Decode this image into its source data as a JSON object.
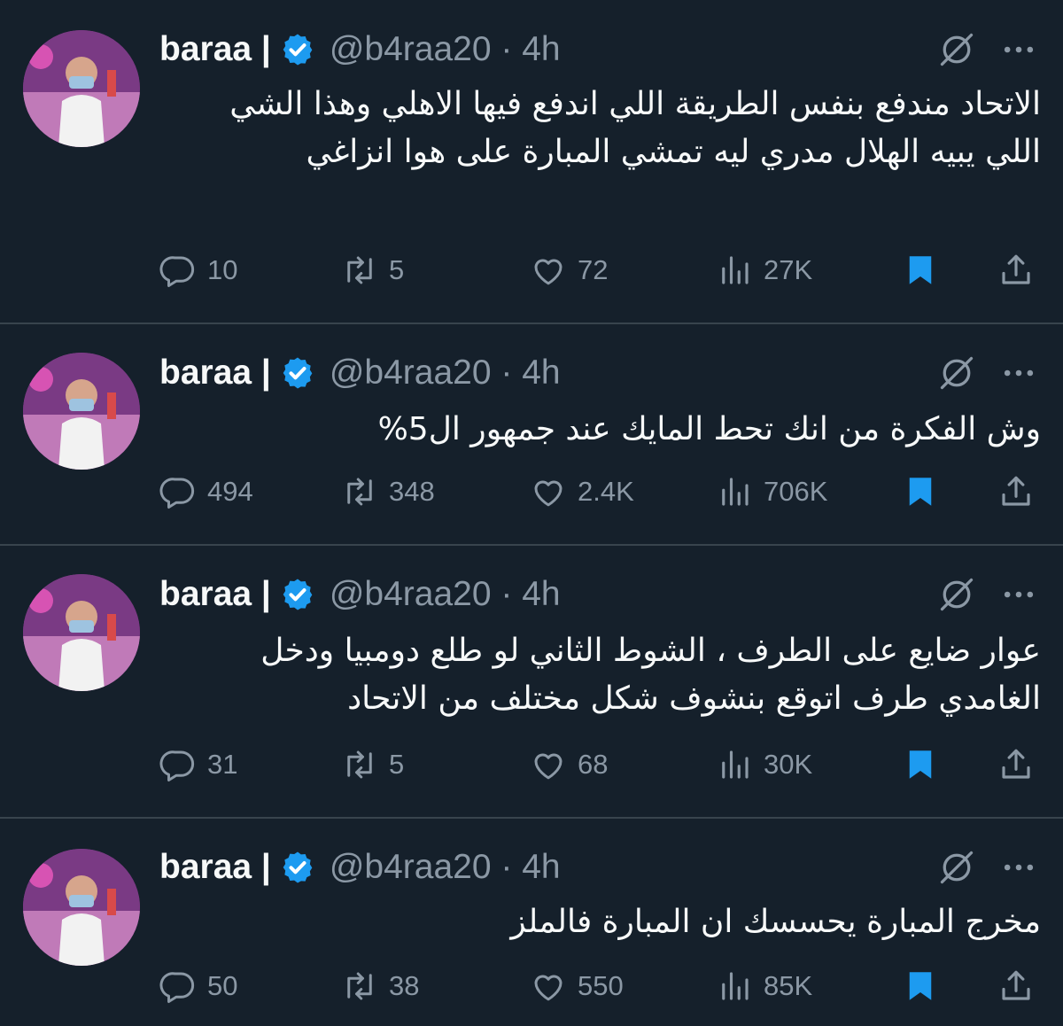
{
  "tweets": [
    {
      "name": "baraa |",
      "handle": "@b4raa20 · 4h",
      "text": "الاتحاد مندفع بنفس الطريقة اللي اندفع فيها الاهلي وهذا الشي اللي يبيه الهلال مدري ليه تمشي المبارة على هوا انزاغي",
      "replies": "10",
      "retweets": "5",
      "likes": "72",
      "views": "27K"
    },
    {
      "name": "baraa |",
      "handle": "@b4raa20 · 4h",
      "text": "وش الفكرة من انك تحط المايك عند جمهور ال5%",
      "replies": "494",
      "retweets": "348",
      "likes": "2.4K",
      "views": "706K"
    },
    {
      "name": "baraa |",
      "handle": "@b4raa20 · 4h",
      "text": "عوار ضايع على الطرف ، الشوط الثاني لو طلع دومبيا ودخل الغامدي طرف اتوقع بنشوف شكل مختلف من الاتحاد",
      "replies": "31",
      "retweets": "5",
      "likes": "68",
      "views": "30K"
    },
    {
      "name": "baraa |",
      "handle": "@b4raa20 · 4h",
      "text": "مخرج المبارة يحسسك ان المبارة فالملز",
      "replies": "50",
      "retweets": "38",
      "likes": "550",
      "views": "85K"
    }
  ],
  "icons": {
    "verified": "verified-badge-icon",
    "grok": "grok-icon",
    "more": "more-icon",
    "reply": "reply-icon",
    "retweet": "retweet-icon",
    "like": "heart-icon",
    "views": "views-icon",
    "bookmark": "bookmark-icon",
    "share": "share-icon"
  },
  "colors": {
    "background": "#15202b",
    "text": "#f7f9f9",
    "muted": "#8b98a5",
    "accent": "#1d9bf0",
    "divider": "#38444d"
  }
}
